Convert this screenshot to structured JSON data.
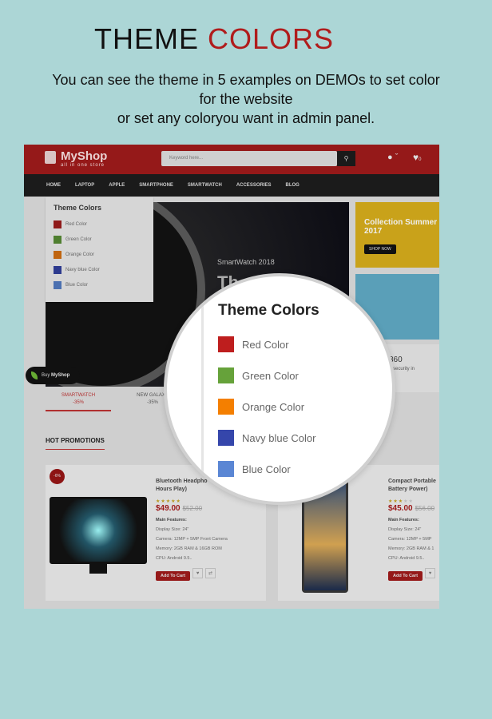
{
  "heading": {
    "part1": "THEME ",
    "part2": "COLORS"
  },
  "description": [
    "You can see the theme in 5 examples on DEMOs to set color",
    "for the website",
    "or set any coloryou want in admin panel."
  ],
  "shop": {
    "logo": "MyShop",
    "tagline": "all in one store",
    "search_placeholder": "Keyword here...",
    "wishlist_count": "0",
    "nav": [
      "HOME",
      "LAPTOP",
      "APPLE",
      "SMARTPHONE",
      "SMARTWATCH",
      "ACCESSORIES",
      "BLOG"
    ],
    "slider": {
      "subtitle": "SmartWatch 2018",
      "title": "Th"
    },
    "banner1": {
      "title": "Collection Summer 2017",
      "button": "SHOP NOW"
    },
    "banner3": {
      "title": "360",
      "text": "n security in"
    },
    "buy_label": "Buy",
    "buy_brand": "MyShop",
    "tabs": [
      {
        "name": "SMARTWATCH",
        "discount": "-35%"
      },
      {
        "name": "NEW GALAXY",
        "discount": "-35%"
      }
    ],
    "section_title": "HOT PROMOTIONS",
    "products": [
      {
        "badge": "-6%",
        "name1": "Bluetooth Headpho",
        "name2": "Hours Play)",
        "rating": 5,
        "stars": "★★★★★",
        "price": "$49.00",
        "old_price": "$52.00",
        "features_title": "Main Features:",
        "features": [
          "Display Size: 24\"",
          "Camera: 12MP + 5MP Front Camera",
          "Memory: 2GB RAM & 16GB ROM",
          "CPU: Android 9.5.."
        ],
        "cart": "Add To Cart"
      },
      {
        "name1": "Compact Portable",
        "name2": "Battery Power)",
        "rating": 3,
        "stars": "★★★★★",
        "price": "$45.00",
        "old_price": "$56.00",
        "features_title": "Main Features:",
        "features": [
          "Display Size: 24\"",
          "Camera: 12MP + 5MP",
          "Memory: 2GB RAM & 1",
          "CPU: Android 9.5.."
        ],
        "cart": "Add To Cart"
      }
    ]
  },
  "theme_colors": {
    "title": "Theme Colors",
    "items": [
      {
        "label": "Red Color",
        "color": "#be1e1e"
      },
      {
        "label": "Green Color",
        "color": "#66a23a"
      },
      {
        "label": "Orange Color",
        "color": "#f47f00"
      },
      {
        "label": "Navy blue Color",
        "color": "#3546ab"
      },
      {
        "label": "Blue Color",
        "color": "#5a86d4"
      }
    ]
  }
}
